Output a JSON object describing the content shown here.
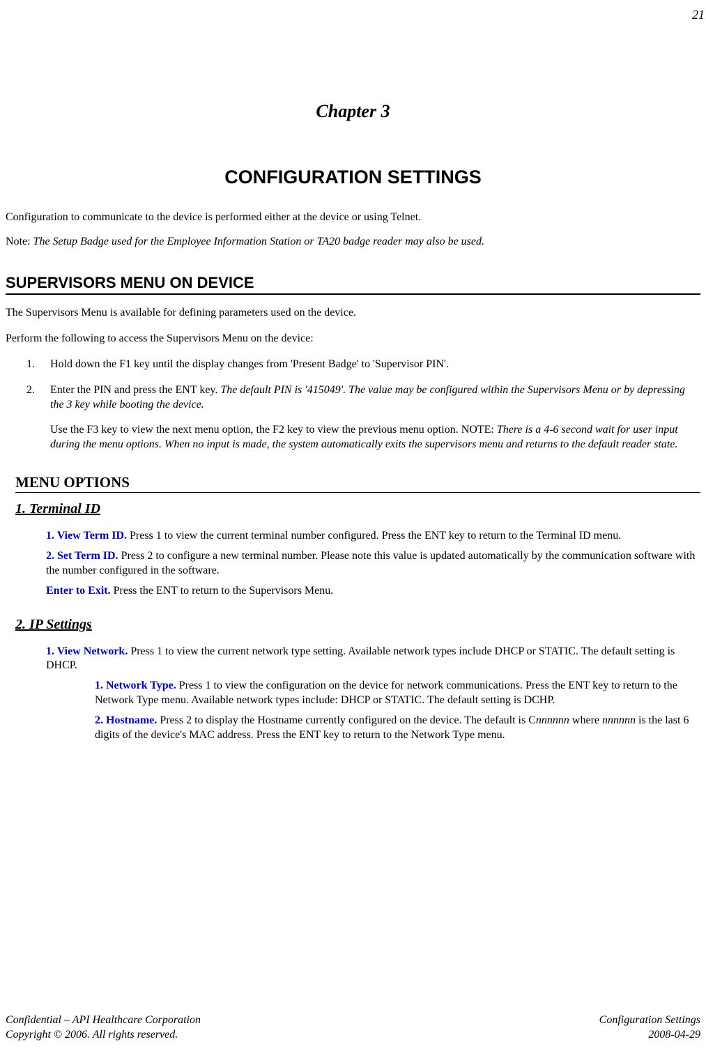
{
  "page_number": "21",
  "chapter_label": "Chapter 3",
  "chapter_title": "CONFIGURATION SETTINGS",
  "intro": "Configuration to communicate to the device is performed either at the device or using Telnet.",
  "note_prefix": "Note:  ",
  "note_body": "The Setup Badge used for the Employee Information Station or TA20 badge reader may also be used.",
  "h1_supervisors": "SUPERVISORS MENU ON DEVICE",
  "sup_p1": "The Supervisors Menu is available for defining parameters used on the device.",
  "sup_p2": "Perform the following to access the Supervisors Menu on the device:",
  "sup_step1_num": "1.",
  "sup_step1": "Hold down the F1 key until the display changes from 'Present Badge' to 'Supervisor PIN'.",
  "sup_step2_num": "2.",
  "sup_step2_a": "Enter the PIN and press the ENT key.  ",
  "sup_step2_b": "The default PIN is '415049'.  The value may be configured within the Supervisors Menu or by depressing the 3 key while booting the device.",
  "sup_step2_c": "Use the F3 key to view the next menu option, the F2 key to view the previous menu option.  NOTE:  ",
  "sup_step2_d": "There is a 4-6 second wait for user input during the menu options.  When no input is made, the system automatically exits the supervisors menu and returns to the default reader state.",
  "h2_menu_options": "MENU OPTIONS",
  "h3_terminal": "1. Terminal ID",
  "term1_label": "1. View Term ID.",
  "term1_body": "  Press 1 to view the current terminal number configured.  Press the ENT key to return to the Terminal ID menu.",
  "term2_label": "2. Set Term ID.",
  "term2_body": "  Press 2 to configure a new terminal number.  Please note this value is updated automatically by the communication software with the number configured in the software.",
  "term3_label": "Enter to Exit.",
  "term3_body": "  Press the ENT to return to the Supervisors Menu.",
  "h3_ip": "2. IP Settings",
  "ip1_label": "1. View Network.",
  "ip1_body": "  Press 1 to view the current network type setting.  Available network types include DHCP or STATIC. The default setting is DHCP.",
  "ip1a_label": "1. Network Type.",
  "ip1a_body": "  Press 1 to view the configuration on the device for network communications.  Press the ENT key to return to the Network Type menu.  Available network types include: DHCP or STATIC.  The default setting is DCHP.",
  "ip1b_label": "2. Hostname.",
  "ip1b_body_a": "  Press 2 to display the Hostname currently configured on the device.  The default is C",
  "ip1b_body_b": "nnnnnn",
  "ip1b_body_c": " where ",
  "ip1b_body_d": "nnnnnn",
  "ip1b_body_e": " is the last 6 digits of the device's MAC address.  Press the ENT key to return to the Network Type menu.",
  "footer_left_1": "Confidential – API Healthcare Corporation",
  "footer_left_2": "Copyright © 2006.  All rights reserved.",
  "footer_right_1": "Configuration Settings",
  "footer_right_2": "2008-04-29"
}
